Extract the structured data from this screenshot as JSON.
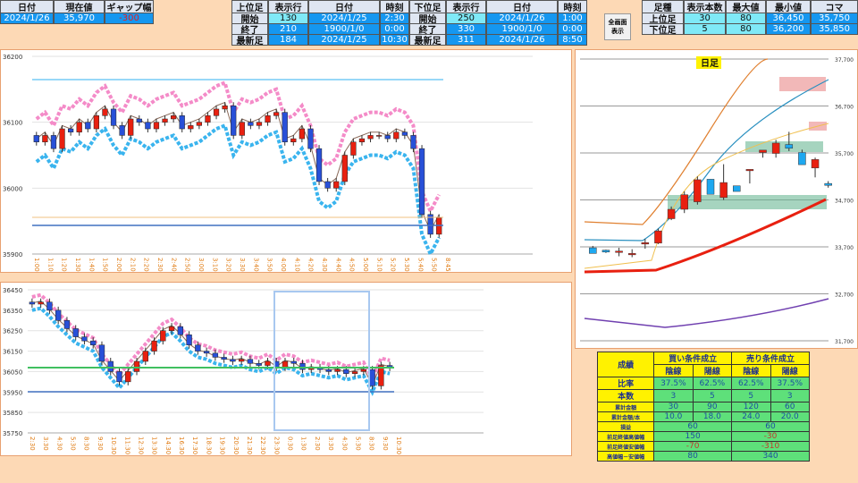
{
  "top_left": {
    "headers": [
      "日付",
      "現在値",
      "ギャップ幅"
    ],
    "values": [
      "2024/1/26",
      "35,970",
      "-300"
    ]
  },
  "upper": {
    "headers": [
      "上位足",
      "表示行",
      "日付",
      "時刻"
    ],
    "rows": [
      [
        "開始",
        "130",
        "2024/1/25",
        "2:30"
      ],
      [
        "終了",
        "210",
        "1900/1/0",
        "0:00"
      ],
      [
        "最新足",
        "184",
        "2024/1/25",
        "10:30"
      ]
    ]
  },
  "lower": {
    "headers": [
      "下位足",
      "表示行",
      "日付",
      "時刻"
    ],
    "rows": [
      [
        "開始",
        "250",
        "2024/1/26",
        "1:00"
      ],
      [
        "終了",
        "330",
        "1900/1/0",
        "0:00"
      ],
      [
        "最新足",
        "311",
        "2024/1/26",
        "8:50"
      ]
    ]
  },
  "fullscreen_button": [
    "全画面",
    "表示"
  ],
  "summary": {
    "headers": [
      "足種",
      "表示本数",
      "最大値",
      "最小値",
      "コマ"
    ],
    "rows": [
      [
        "上位足",
        "30",
        "80",
        "36,450",
        "35,750"
      ],
      [
        "下位足",
        "5",
        "80",
        "36,200",
        "35,850"
      ]
    ]
  },
  "results": {
    "title": "成績",
    "buy": "買い条件成立",
    "sell": "売り条件成立",
    "yin": "陰線",
    "yang": "陽線",
    "rows": [
      {
        "label": "比率",
        "v": [
          "37.5%",
          "62.5%",
          "62.5%",
          "37.5%"
        ]
      },
      {
        "label": "本数",
        "v": [
          "3",
          "5",
          "5",
          "3"
        ]
      },
      {
        "label": "累計金額",
        "v": [
          "30",
          "90",
          "120",
          "60"
        ]
      },
      {
        "label": "累計金額/本",
        "v": [
          "10.0",
          "18.0",
          "24.0",
          "20.0"
        ]
      }
    ],
    "merged": [
      {
        "label": "損益",
        "v": [
          "60",
          "60"
        ]
      },
      {
        "label": "前足終値高値幅",
        "v": [
          "150",
          "-30"
        ]
      },
      {
        "label": "前足終値安値幅",
        "v": [
          "-70",
          "-310"
        ]
      },
      {
        "label": "高値幅－安値幅",
        "v": [
          "80",
          "340"
        ]
      }
    ]
  },
  "chart_data": [
    {
      "type": "candlestick",
      "name": "5min",
      "ylim": [
        35900,
        36200
      ],
      "yticks": [
        "36200",
        "36100",
        "36000",
        "35900"
      ],
      "xticks": [
        "1:00",
        "1:10",
        "1:20",
        "1:30",
        "1:40",
        "1:50",
        "2:00",
        "2:10",
        "2:20",
        "2:30",
        "2:40",
        "2:50",
        "3:00",
        "3:10",
        "3:20",
        "3:30",
        "3:40",
        "3:50",
        "4:00",
        "4:10",
        "4:20",
        "4:30",
        "4:40",
        "4:50",
        "5:00",
        "5:10",
        "5:20",
        "5:30",
        "5:40",
        "5:50",
        "8:45"
      ],
      "closes": [
        36070,
        36080,
        36060,
        36090,
        36085,
        36100,
        36090,
        36110,
        36120,
        36095,
        36080,
        36105,
        36100,
        36090,
        36100,
        36105,
        36110,
        36090,
        36095,
        36100,
        36110,
        36120,
        36125,
        36080,
        36100,
        36095,
        36100,
        36110,
        36115,
        36070,
        36075,
        36090,
        36060,
        36010,
        36000,
        36010,
        36050,
        36070,
        36075,
        36080,
        36080,
        36075,
        36085,
        36080,
        36060,
        35960,
        35930,
        35955
      ]
    },
    {
      "type": "candlestick",
      "name": "30min",
      "ylim": [
        35750,
        36450
      ],
      "yticks": [
        "36450",
        "36350",
        "36250",
        "36150",
        "36050",
        "35950",
        "35850",
        "35750"
      ],
      "xticks": [
        "2:30",
        "3:30",
        "4:30",
        "5:30",
        "8:30",
        "9:30",
        "10:30",
        "11:30",
        "12:30",
        "13:30",
        "14:30",
        "16:30",
        "17:30",
        "18:30",
        "19:30",
        "20:30",
        "21:30",
        "22:30",
        "23:30",
        "0:30",
        "1:30",
        "2:30",
        "3:30",
        "4:30",
        "5:30",
        "8:30",
        "9:30",
        "10:30"
      ],
      "closes": [
        36380,
        36390,
        36350,
        36300,
        36260,
        36220,
        36200,
        36180,
        36100,
        36050,
        36000,
        36050,
        36100,
        36150,
        36200,
        36250,
        36270,
        36230,
        36180,
        36150,
        36140,
        36120,
        36110,
        36100,
        36110,
        36090,
        36080,
        36100,
        36070,
        36100,
        36090,
        36060,
        36070,
        36060,
        36050,
        36060,
        36040,
        36050,
        36060,
        35980,
        36080,
        36070
      ]
    },
    {
      "type": "candlestick",
      "name": "日足",
      "title": "日足",
      "ylim": [
        31700,
        37700
      ],
      "yticks": [
        "37,700",
        "36,700",
        "35,700",
        "34,700",
        "33,700",
        "32,700",
        "31,700"
      ],
      "candles": [
        [
          33680,
          33720,
          33580,
          33560
        ],
        [
          33630,
          33640,
          33570,
          33590
        ],
        [
          33600,
          33680,
          33500,
          33610
        ],
        [
          33540,
          33650,
          33480,
          33560
        ],
        [
          33760,
          33870,
          33660,
          33790
        ],
        [
          33780,
          34090,
          33760,
          34040
        ],
        [
          34300,
          34560,
          34270,
          34500
        ],
        [
          34500,
          34880,
          34420,
          34810
        ],
        [
          34660,
          35200,
          34600,
          35130
        ],
        [
          35140,
          35140,
          35040,
          34820
        ],
        [
          34750,
          35460,
          34700,
          35070
        ],
        [
          35000,
          35000,
          34900,
          34880
        ],
        [
          35330,
          35340,
          35050,
          35350
        ],
        [
          35710,
          35710,
          35600,
          35760
        ],
        [
          35690,
          35980,
          35600,
          35910
        ],
        [
          35880,
          36150,
          35740,
          35800
        ],
        [
          35710,
          35770,
          35650,
          35450
        ],
        [
          35380,
          35600,
          35180,
          35560
        ],
        [
          35050,
          35100,
          34960,
          35010
        ]
      ]
    }
  ]
}
